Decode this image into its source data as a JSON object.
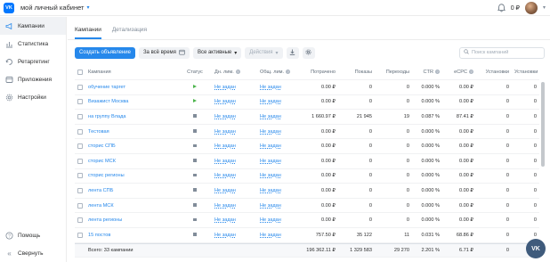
{
  "header": {
    "logo_text": "VK",
    "cabinet_label": "мой личный кабинет",
    "balance": "0 ₽"
  },
  "sidebar": {
    "items": [
      {
        "label": "Кампании",
        "icon": "megaphone-icon",
        "active": true
      },
      {
        "label": "Статистика",
        "icon": "chart-icon",
        "active": false
      },
      {
        "label": "Ретаргетинг",
        "icon": "retarget-icon",
        "active": false
      },
      {
        "label": "Приложения",
        "icon": "apps-icon",
        "active": false
      },
      {
        "label": "Настройки",
        "icon": "gear-icon",
        "active": false
      }
    ],
    "bottom": [
      {
        "label": "Помощь",
        "icon": "help-icon"
      },
      {
        "label": "Свернуть",
        "icon": "collapse-icon"
      }
    ]
  },
  "tabs": [
    {
      "label": "Кампании",
      "active": true
    },
    {
      "label": "Детализация",
      "active": false
    }
  ],
  "toolbar": {
    "create_label": "Создать объявление",
    "period_label": "За всё время",
    "filter_label": "Все активные",
    "actions_label": "Действия",
    "search_placeholder": "Поиск кампаний"
  },
  "table": {
    "headers": {
      "name": "Кампания",
      "status": "Статус",
      "dl": "Дн. лим.",
      "ol": "Общ. лим.",
      "spent": "Потрачено",
      "shows": "Показы",
      "clicks": "Переходы",
      "ctr": "CTR",
      "ecpc": "eCPC",
      "inst": "Установки",
      "inst2": "Установки"
    },
    "rows": [
      {
        "name": "обучение таргет",
        "status": "active",
        "dl": "Не задан",
        "ol": "Не задан",
        "spent": "0.00 ₽",
        "shows": "0",
        "clicks": "0",
        "ctr": "0.000 %",
        "ecpc": "0.00 ₽",
        "inst": "0",
        "inst2": "0"
      },
      {
        "name": "Визажист Москва",
        "status": "active",
        "dl": "Не задан",
        "ol": "Не задан",
        "spent": "0.00 ₽",
        "shows": "0",
        "clicks": "0",
        "ctr": "0.000 %",
        "ecpc": "0.00 ₽",
        "inst": "0",
        "inst2": "0"
      },
      {
        "name": "на группу Влада",
        "status": "stopped",
        "dl": "Не задан",
        "ol": "Не задан",
        "spent": "1 660.97 ₽",
        "shows": "21 945",
        "clicks": "19",
        "ctr": "0.087 %",
        "ecpc": "87.41 ₽",
        "inst": "0",
        "inst2": "0"
      },
      {
        "name": "Тестовая",
        "status": "stopped",
        "dl": "Не задан",
        "ol": "Не задан",
        "spent": "0.00 ₽",
        "shows": "0",
        "clicks": "0",
        "ctr": "0.000 %",
        "ecpc": "0.00 ₽",
        "inst": "0",
        "inst2": "0"
      },
      {
        "name": "сторис СПБ",
        "status": "stopped",
        "dl": "Не задан",
        "ol": "Не задан",
        "spent": "0.00 ₽",
        "shows": "0",
        "clicks": "0",
        "ctr": "0.000 %",
        "ecpc": "0.00 ₽",
        "inst": "0",
        "inst2": "0"
      },
      {
        "name": "сторис МСК",
        "status": "stopped",
        "dl": "Не задан",
        "ol": "Не задан",
        "spent": "0.00 ₽",
        "shows": "0",
        "clicks": "0",
        "ctr": "0.000 %",
        "ecpc": "0.00 ₽",
        "inst": "0",
        "inst2": "0"
      },
      {
        "name": "сторис регионы",
        "status": "stopped",
        "dl": "Не задан",
        "ol": "Не задан",
        "spent": "0.00 ₽",
        "shows": "0",
        "clicks": "0",
        "ctr": "0.000 %",
        "ecpc": "0.00 ₽",
        "inst": "0",
        "inst2": "0"
      },
      {
        "name": "лента СПБ",
        "status": "stopped",
        "dl": "Не задан",
        "ol": "Не задан",
        "spent": "0.00 ₽",
        "shows": "0",
        "clicks": "0",
        "ctr": "0.000 %",
        "ecpc": "0.00 ₽",
        "inst": "0",
        "inst2": "0"
      },
      {
        "name": "лента МСК",
        "status": "stopped",
        "dl": "Не задан",
        "ol": "Не задан",
        "spent": "0.00 ₽",
        "shows": "0",
        "clicks": "0",
        "ctr": "0.000 %",
        "ecpc": "0.00 ₽",
        "inst": "0",
        "inst2": "0"
      },
      {
        "name": "лента регионы",
        "status": "stopped",
        "dl": "Не задан",
        "ol": "Не задан",
        "spent": "0.00 ₽",
        "shows": "0",
        "clicks": "0",
        "ctr": "0.000 %",
        "ecpc": "0.00 ₽",
        "inst": "0",
        "inst2": "0"
      },
      {
        "name": "15 постов",
        "status": "stopped",
        "dl": "Не задан",
        "ol": "Не задан",
        "spent": "757.50 ₽",
        "shows": "35 122",
        "clicks": "11",
        "ctr": "0.031 %",
        "ecpc": "68.86 ₽",
        "inst": "0",
        "inst2": "0"
      }
    ],
    "total": {
      "name": "Всего: 33 кампании",
      "spent": "196 362.11 ₽",
      "shows": "1 329 583",
      "clicks": "29 270",
      "ctr": "2.201 %",
      "ecpc": "6.71 ₽",
      "inst": "0",
      "inst2": "0"
    }
  },
  "colors": {
    "accent": "#2688eb",
    "active_status": "#4bb34b",
    "stopped_status": "#818c99"
  },
  "fab_label": "VK"
}
